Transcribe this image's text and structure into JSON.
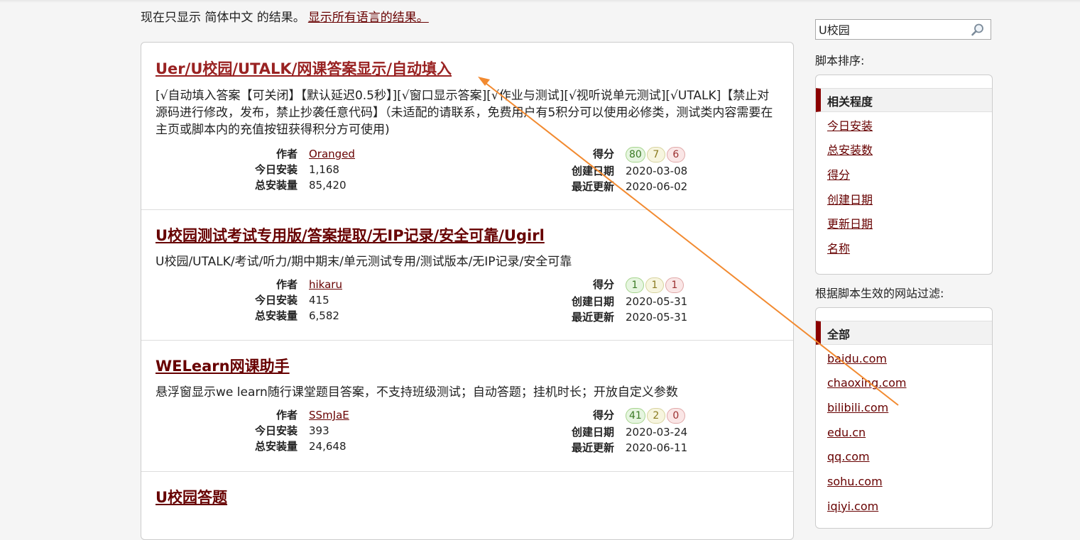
{
  "language_filter": {
    "label": "现在只显示 简体中文 的结果。",
    "link": "显示所有语言的结果。"
  },
  "meta_labels": {
    "author": "作者",
    "today_installs": "今日安装",
    "total_installs": "总安装量",
    "rating": "得分",
    "created": "创建日期",
    "updated": "最近更新"
  },
  "scripts": [
    {
      "title": "Uer/U校园/UTALK/网课答案显示/自动填入",
      "description": "[√自动填入答案【可关闭】【默认延迟0.5秒】][√窗口显示答案][√作业与测试][√视听说单元测试][√UTALK]【禁止对源码进行修改，发布，禁止抄袭任意代码】（未适配的请联系，免费用户有5积分可以使用必修类，测试类内容需要在主页或脚本内的充值按钮获得积分方可使用)",
      "author": "Oranged",
      "today_installs": "1,168",
      "total_installs": "85,420",
      "rating_good": "80",
      "rating_ok": "7",
      "rating_bad": "6",
      "created": "2020-03-08",
      "updated": "2020-06-02"
    },
    {
      "title": "U校园测试考试专用版/答案提取/无IP记录/安全可靠/Ugirl",
      "description": "U校园/UTALK/考试/听力/期中期末/单元测试专用/测试版本/无IP记录/安全可靠",
      "author": "hikaru",
      "today_installs": "415",
      "total_installs": "6,582",
      "rating_good": "1",
      "rating_ok": "1",
      "rating_bad": "1",
      "created": "2020-05-31",
      "updated": "2020-05-31"
    },
    {
      "title": "WELearn网课助手",
      "description": "悬浮窗显示we learn随行课堂题目答案，不支持班级测试；自动答题；挂机时长；开放自定义参数",
      "author": "SSmJaE",
      "today_installs": "393",
      "total_installs": "24,648",
      "rating_good": "41",
      "rating_ok": "2",
      "rating_bad": "0",
      "created": "2020-03-24",
      "updated": "2020-06-11"
    },
    {
      "title": "U校园答题",
      "description": ""
    }
  ],
  "search": {
    "value": "U校园",
    "icon": "magnifier-icon"
  },
  "sort": {
    "label": "脚本排序:",
    "active": "相关程度",
    "options": [
      "今日安装",
      "总安装数",
      "得分",
      "创建日期",
      "更新日期",
      "名称"
    ]
  },
  "site_filter": {
    "label": "根据脚本生效的网站过滤:",
    "active": "全部",
    "sites": [
      "baidu.com",
      "chaoxing.com",
      "bilibili.com",
      "edu.cn",
      "qq.com",
      "sohu.com",
      "iqiyi.com"
    ]
  },
  "annotation": {
    "color": "#f28a30"
  }
}
